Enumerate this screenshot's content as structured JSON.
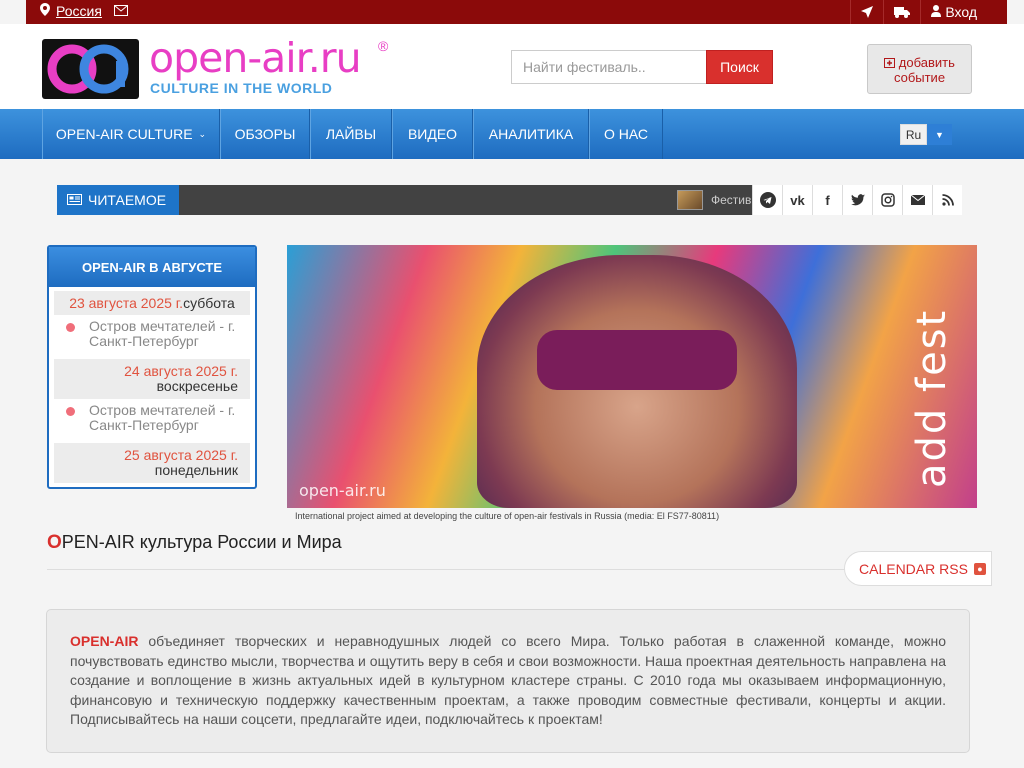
{
  "topbar": {
    "country": "Россия",
    "login": "Вход",
    "icons": [
      "map-marker-icon",
      "envelope-icon",
      "location-arrow-icon",
      "truck-icon",
      "user-icon"
    ]
  },
  "logo": {
    "title": "open-air.ru",
    "reg": "®",
    "subtitle": "CULTURE IN THE WORLD"
  },
  "search": {
    "placeholder": "Найти фестиваль..",
    "button": "Поиск"
  },
  "add_event": {
    "line1": "добавить",
    "line2": "событие"
  },
  "nav": {
    "items": [
      "OPEN-AIR CULTURE",
      "ОБЗОРЫ",
      "ЛАЙВЫ",
      "ВИДЕО",
      "АНАЛИТИКА",
      "О НАС"
    ],
    "lang": "Ru"
  },
  "reading": {
    "label": "ЧИТАЕМОЕ",
    "ticker": "Фестив"
  },
  "social": [
    "telegram-icon",
    "vk-icon",
    "facebook-icon",
    "twitter-icon",
    "instagram-icon",
    "mail-icon",
    "rss-icon"
  ],
  "calendar": {
    "title": "OPEN-AIR В АВГУСТЕ",
    "days": [
      {
        "date": "23 августа 2025 г.",
        "weekday": "суббота",
        "event": "Остров мечтателей - г. Санкт-Петербург"
      },
      {
        "date": "24 августа 2025 г.",
        "weekday": "воскресенье",
        "event": "Остров мечтателей - г. Санкт-Петербург"
      },
      {
        "date": "25 августа 2025 г.",
        "weekday": "понедельник"
      }
    ]
  },
  "banner": {
    "brand": "open-air.ru",
    "vertical": "add fest",
    "caption": "International project aimed at developing the culture of open-air festivals in Russia (media: El FS77-80811)"
  },
  "heading": {
    "first": "O",
    "rest": "PEN-AIR культура России и Мира"
  },
  "rss": {
    "label": "CALENDAR RSS"
  },
  "about": {
    "brand": "OPEN-AIR",
    "text": " объединяет творческих и неравнодушных людей со всего Мира. Только работая в слаженной команде, можно почувствовать единство мысли, творчества и ощутить веру в себя и свои возможности. Наша проектная деятельность направлена на создание и воплощение в жизнь актуальных идей в культурном кластере страны. С 2010 года мы оказываем информационную, финансовую и техническую поддержку качественным проектам, а также проводим совместные фестивали, концерты и акции. Подписывайтесь на наши соцсети, предлагайте идеи, подключайтесь к проектам!"
  },
  "colors": {
    "topbar": "#8b0a0a",
    "nav": "#1e6cc0",
    "accent": "#d9302d",
    "logo_pink": "#e83ec4",
    "logo_blue": "#4aa0e0"
  }
}
